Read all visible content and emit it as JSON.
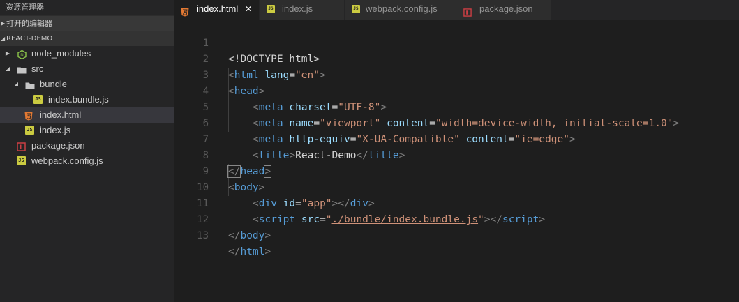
{
  "sidebar": {
    "header": "资源管理器",
    "open_editors_label": "打开的编辑器",
    "project_label": "REACT-DEMO",
    "items": [
      {
        "label": "node_modules"
      },
      {
        "label": "src"
      },
      {
        "label": "bundle"
      },
      {
        "label": "index.bundle.js"
      },
      {
        "label": "index.html"
      },
      {
        "label": "index.js"
      },
      {
        "label": "package.json"
      },
      {
        "label": "webpack.config.js"
      }
    ]
  },
  "tabs": [
    {
      "label": "index.html",
      "close": "✕"
    },
    {
      "label": "index.js"
    },
    {
      "label": "webpack.config.js"
    },
    {
      "label": "package.json"
    }
  ],
  "editor": {
    "line_numbers": [
      "1",
      "2",
      "3",
      "4",
      "5",
      "6",
      "7",
      "8",
      "9",
      "10",
      "11",
      "12",
      "13"
    ],
    "lines": {
      "l1": {
        "text": "<!DOCTYPE html>"
      },
      "l2": {
        "open": "<",
        "tag": "html",
        "attr": "lang",
        "eq": "=",
        "val": "\"en\"",
        "close": ">"
      },
      "l3": {
        "open": "<",
        "tag": "head",
        "close": ">"
      },
      "l4": {
        "open": "<",
        "tag": "meta",
        "attr": "charset",
        "eq": "=",
        "val": "\"UTF-8\"",
        "close": ">"
      },
      "l5": {
        "open": "<",
        "tag": "meta",
        "attr1": "name",
        "val1": "\"viewport\"",
        "attr2": "content",
        "val2": "\"width=device-width, initial-scale=1.0\"",
        "close": ">"
      },
      "l6": {
        "open": "<",
        "tag": "meta",
        "attr1": "http-equiv",
        "val1": "\"X-UA-Compatible\"",
        "attr2": "content",
        "val2": "\"ie=edge\"",
        "close": ">"
      },
      "l7": {
        "open": "<",
        "tag": "title",
        "close": ">",
        "text": "React-Demo",
        "endopen": "</",
        "endtag": "title",
        "endclose": ">"
      },
      "l8": {
        "open": "</",
        "tag": "head",
        "close": ">"
      },
      "l9": {
        "open": "<",
        "tag": "body",
        "close": ">"
      },
      "l10": {
        "open": "<",
        "tag": "div",
        "attr": "id",
        "eq": "=",
        "val": "\"app\"",
        "close": ">",
        "endopen": "</",
        "endtag": "div",
        "endclose": ">"
      },
      "l11": {
        "open": "<",
        "tag": "script",
        "attr": "src",
        "eq": "=",
        "q1": "\"",
        "val": "./bundle/index.bundle.js",
        "q2": "\"",
        "close": ">",
        "endopen": "</",
        "endtag": "script",
        "endclose": ">"
      },
      "l12": {
        "open": "</",
        "tag": "body",
        "close": ">"
      },
      "l13": {
        "open": "</",
        "tag": "html",
        "close": ">"
      }
    }
  },
  "colors": {
    "tag": "#569cd6",
    "attribute": "#9cdcfe",
    "string": "#ce9178",
    "punctuation": "#808080",
    "js_icon": "#cbcb41",
    "html_icon": "#e37933",
    "package_icon": "#cc3e44",
    "node_icon": "#8bc34a"
  },
  "icons": {
    "js": "js-file-icon",
    "html": "html5-file-icon",
    "package": "npm-package-icon",
    "folder": "folder-icon",
    "node_modules": "nodejs-icon"
  }
}
